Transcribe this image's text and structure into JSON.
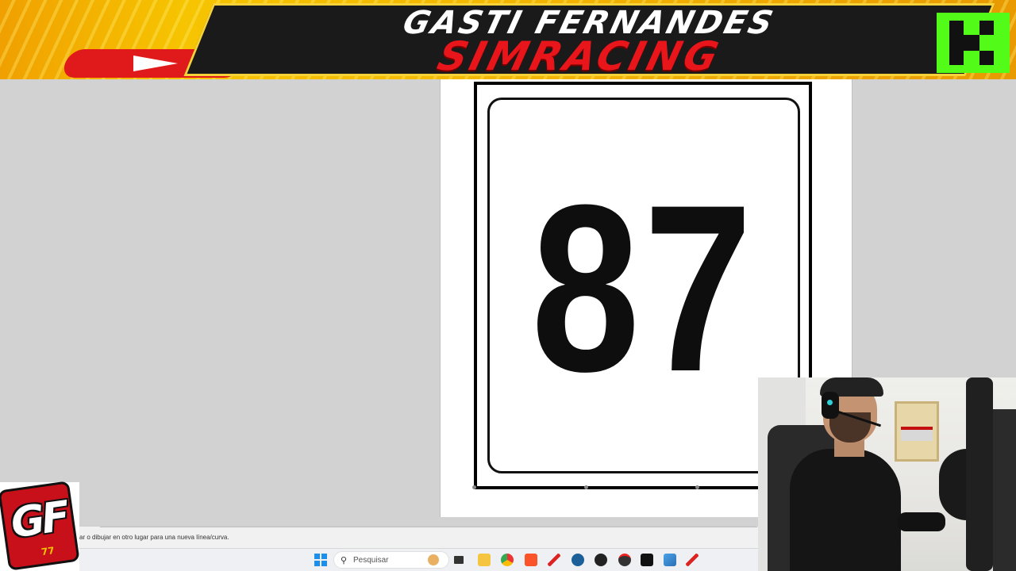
{
  "banner": {
    "line1": "GASTI FERNANDES",
    "line2": "SIMRACING",
    "youtube_icon": "youtube-play-icon",
    "kick_icon": "kick-logo-icon",
    "colors": {
      "accent_red": "#e8151b",
      "banner_yellow": "#f6c400",
      "kick_green": "#53fc18"
    }
  },
  "canvas": {
    "race_number": "87"
  },
  "status_bar": {
    "text": "ar o dibujar en otro lugar para una nueva línea/curva."
  },
  "taskbar": {
    "search_placeholder": "Pesquisar",
    "icons": [
      "windows-start-icon",
      "search-icon",
      "cat-icon",
      "task-view-icon",
      "file-explorer-icon",
      "chrome-icon",
      "brave-icon",
      "pen-app-icon",
      "steam-icon",
      "obs-icon",
      "app-icon",
      "terminal-icon",
      "paint-icon",
      "pen-app-2-icon"
    ]
  },
  "overlay": {
    "logo_text": "GF",
    "logo_number": "77"
  }
}
